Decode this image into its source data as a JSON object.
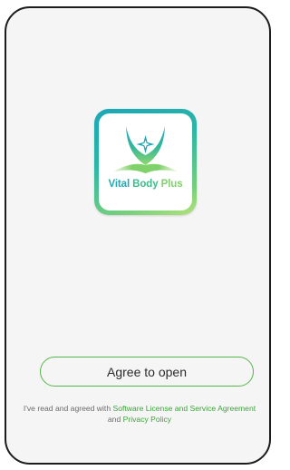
{
  "logo": {
    "word_1": "Vital",
    "word_2": "Body",
    "word_3": "Plus",
    "icon": "lotus-star-icon",
    "gradient_colors": [
      "#1ba7b8",
      "#2bb6a6",
      "#74cf7d",
      "#b5e27a"
    ]
  },
  "agree_button": {
    "label": "Agree to open"
  },
  "consent": {
    "prefix": "I've read and agreed with ",
    "license_link": "Software License and Service Agreement",
    "conjunction": " and ",
    "privacy_link": "Privacy Policy"
  },
  "colors": {
    "accent": "#55b54a",
    "link": "#3ea33b",
    "background": "#f5f5f5"
  }
}
